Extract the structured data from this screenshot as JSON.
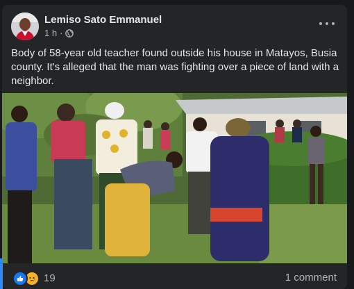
{
  "post": {
    "author": "Lemiso Sato Emmanuel",
    "time": "1 h",
    "separator": "·",
    "privacy_icon": "globe-icon",
    "text": "Body of 58-year old teacher found outside his house in Matayos, Busia county. It's alleged that the man was fighting over a piece of land with a neighbor.",
    "more_icon": "more-options-icon"
  },
  "footer": {
    "reaction_icons": [
      "like-reaction-icon",
      "sad-reaction-icon"
    ],
    "reaction_count": "19",
    "comments": "1 comment"
  },
  "colors": {
    "background": "#18191a",
    "card": "#242526",
    "primary_text": "#e4e6eb",
    "secondary_text": "#b0b3b8",
    "like_blue": "#1877f2",
    "sad_yellow": "#f7b125"
  }
}
